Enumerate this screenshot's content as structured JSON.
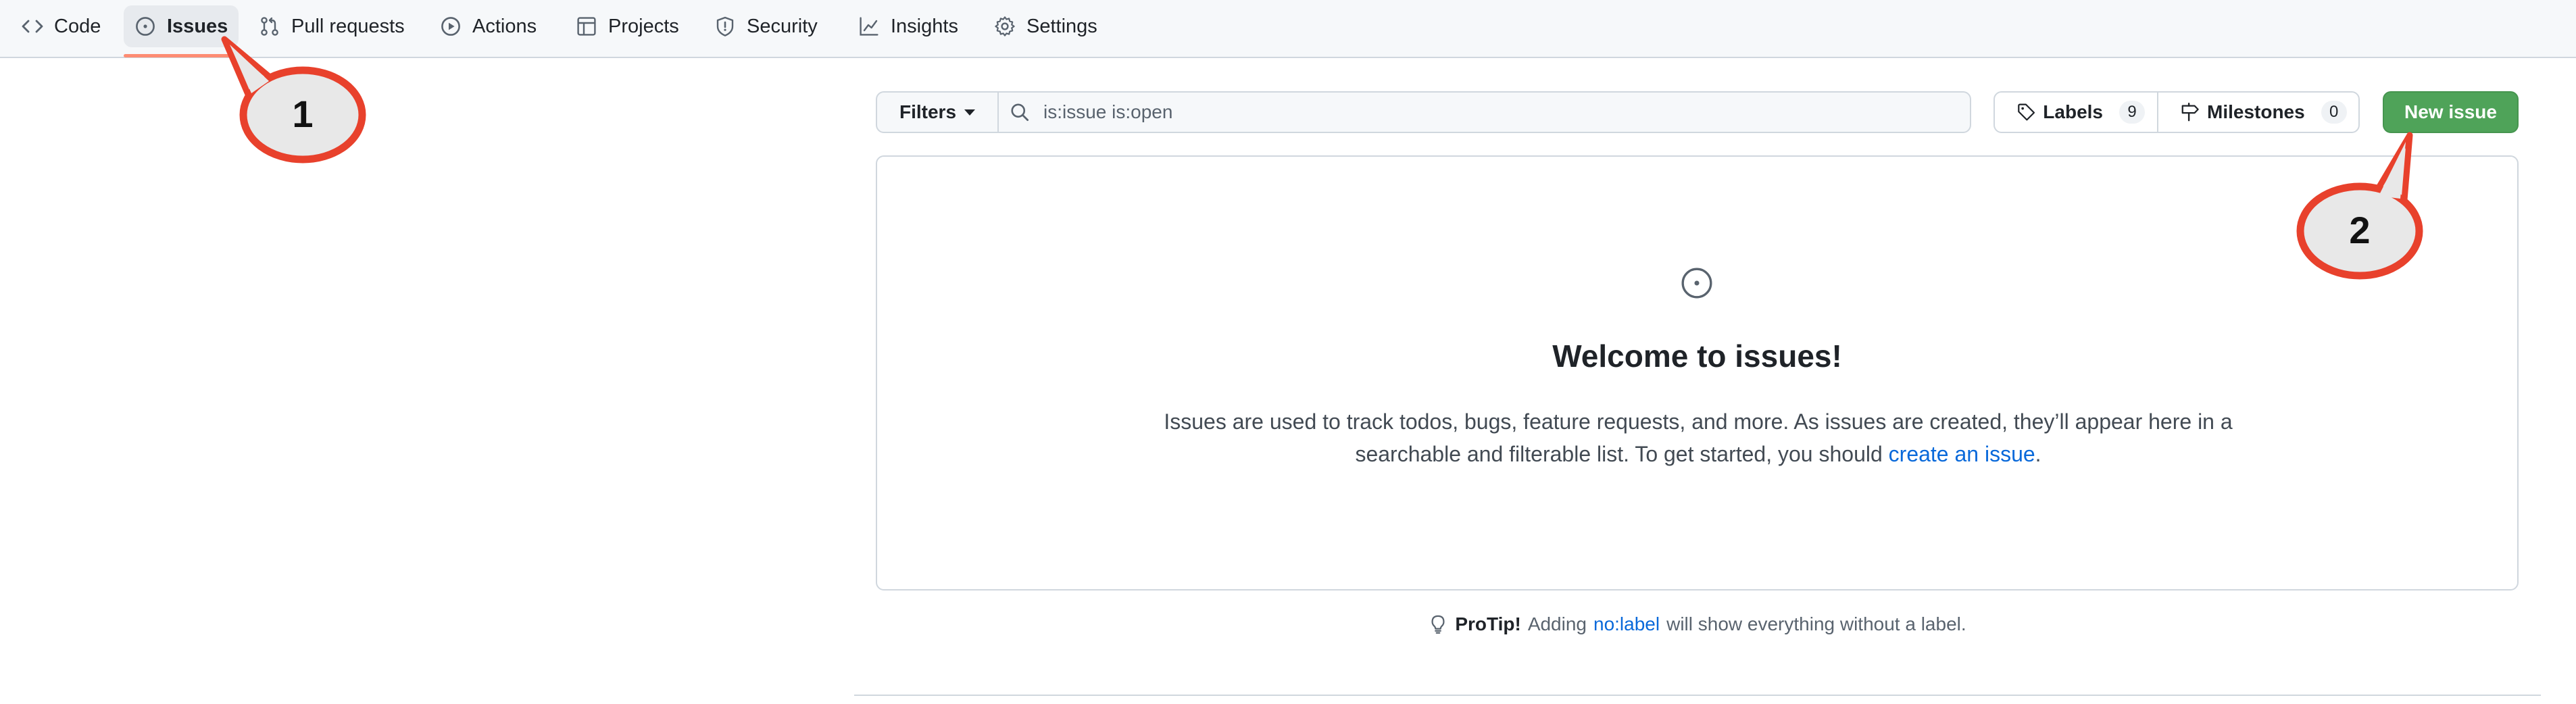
{
  "nav": {
    "items": [
      {
        "label": "Code",
        "icon": "code-icon"
      },
      {
        "label": "Issues",
        "icon": "issue-opened-icon",
        "selected": true
      },
      {
        "label": "Pull requests",
        "icon": "git-pull-request-icon"
      },
      {
        "label": "Actions",
        "icon": "play-icon"
      },
      {
        "label": "Projects",
        "icon": "table-icon"
      },
      {
        "label": "Security",
        "icon": "shield-icon"
      },
      {
        "label": "Insights",
        "icon": "graph-icon"
      },
      {
        "label": "Settings",
        "icon": "gear-icon"
      }
    ]
  },
  "toolbar": {
    "filters_label": "Filters",
    "search_value": "is:issue is:open",
    "labels_label": "Labels",
    "labels_count": "9",
    "milestones_label": "Milestones",
    "milestones_count": "0",
    "new_issue_label": "New issue"
  },
  "blankslate": {
    "title": "Welcome to issues!",
    "text_before_link": "Issues are used to track todos, bugs, feature requests, and more. As issues are created, they’ll appear here in a searchable and filterable list. To get started, you should ",
    "link_text": "create an issue",
    "text_after_link": "."
  },
  "protip": {
    "strong": "ProTip!",
    "before": "Adding",
    "link": "no:label",
    "after": "will show everything without a label."
  },
  "annotations": {
    "callout_1": "1",
    "callout_2": "2",
    "color": "#e8412c"
  },
  "colors": {
    "accent_blue": "#0969da",
    "primary_green": "#4fa359",
    "nav_underline": "#fd8c73"
  }
}
